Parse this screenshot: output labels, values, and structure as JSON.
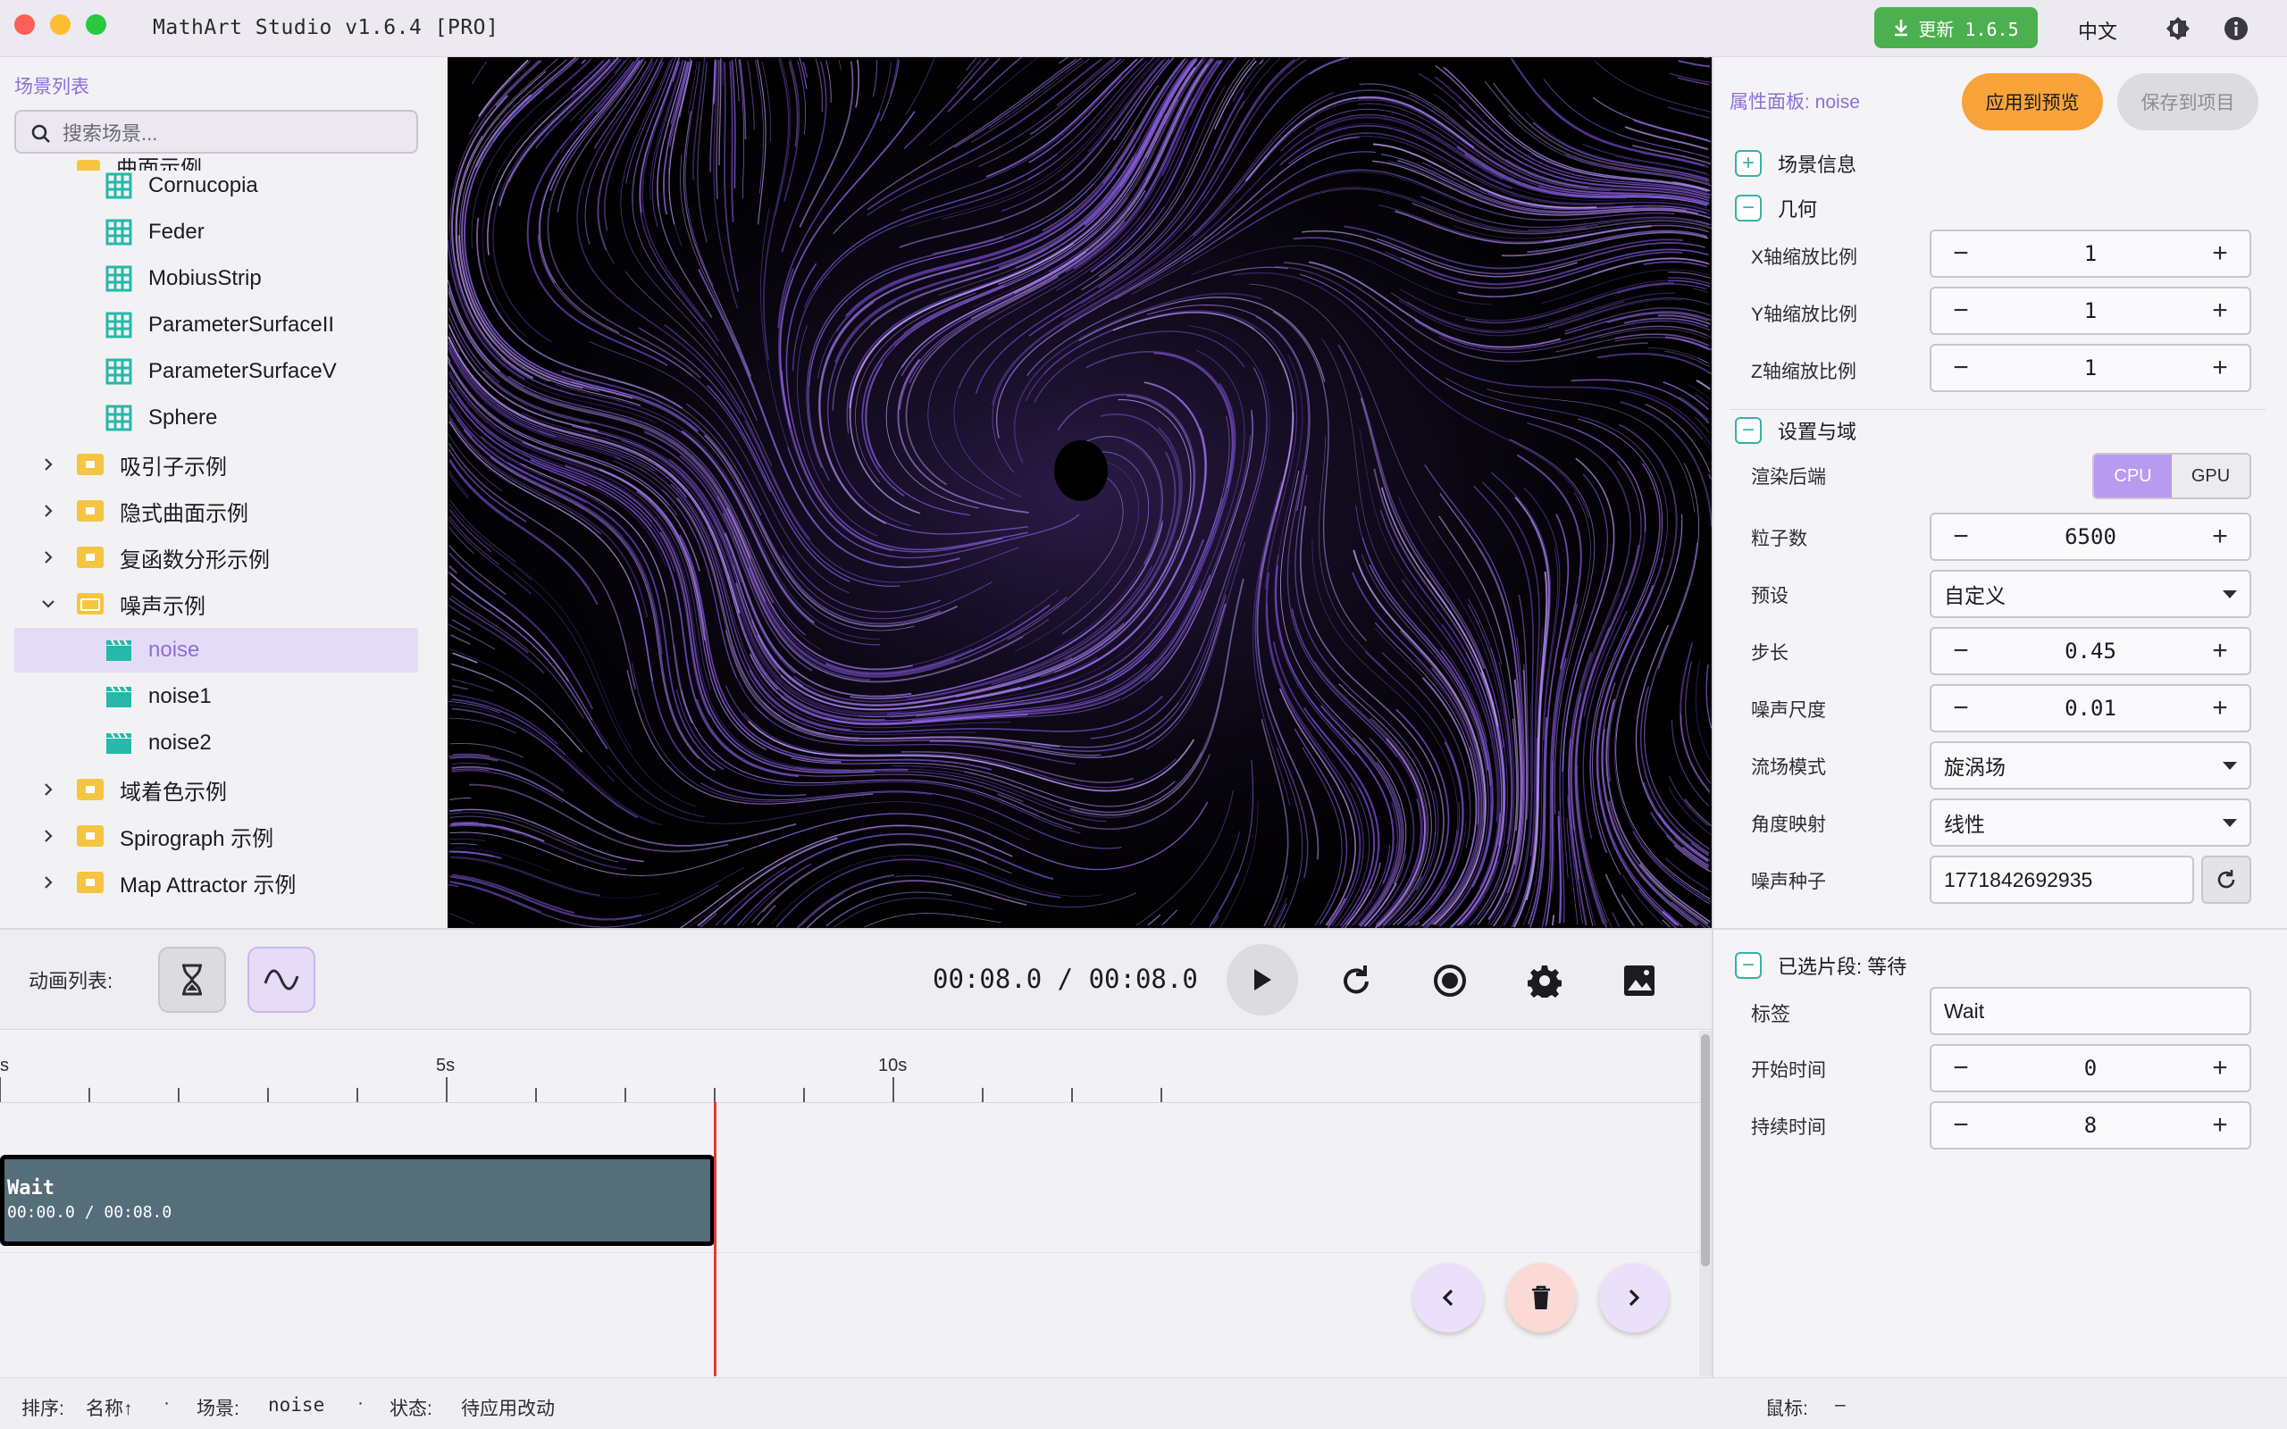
{
  "window": {
    "title": "MathArt Studio v1.6.4 [PRO]"
  },
  "header": {
    "update_label": "更新 1.6.5",
    "language": "中文",
    "theme_icon": "brightness-icon",
    "info_icon": "info-icon",
    "colors": {
      "update": "#4caf50",
      "accent": "#8d6fd6"
    }
  },
  "sidebar": {
    "title": "场景列表",
    "search_placeholder": "搜索场景...",
    "partial_group": "曲面示例",
    "items": [
      {
        "label": "Cornucopia",
        "type": "grid"
      },
      {
        "label": "Feder",
        "type": "grid"
      },
      {
        "label": "MobiusStrip",
        "type": "grid"
      },
      {
        "label": "ParameterSurfaceII",
        "type": "grid"
      },
      {
        "label": "ParameterSurfaceV",
        "type": "grid"
      },
      {
        "label": "Sphere",
        "type": "grid"
      },
      {
        "label": "吸引子示例",
        "type": "folder",
        "expanded": false
      },
      {
        "label": "隐式曲面示例",
        "type": "folder",
        "expanded": false
      },
      {
        "label": "复函数分形示例",
        "type": "folder",
        "expanded": false
      },
      {
        "label": "噪声示例",
        "type": "folder",
        "expanded": true
      },
      {
        "label": "noise",
        "type": "clip",
        "selected": true
      },
      {
        "label": "noise1",
        "type": "clip"
      },
      {
        "label": "noise2",
        "type": "clip"
      },
      {
        "label": "域着色示例",
        "type": "folder",
        "expanded": false
      },
      {
        "label": "Spirograph 示例",
        "type": "folder",
        "expanded": false
      },
      {
        "label": "Map Attractor 示例",
        "type": "folder",
        "expanded": false
      }
    ]
  },
  "props": {
    "title": "属性面板: noise",
    "apply_label": "应用到预览",
    "save_label": "保存到项目",
    "sections": {
      "scene_info": "场景信息",
      "geometry": "几何",
      "settings": "设置与域",
      "selected_clip": "已选片段: 等待"
    },
    "geometry": {
      "x_label": "X轴缩放比例",
      "x_value": "1",
      "y_label": "Y轴缩放比例",
      "y_value": "1",
      "z_label": "Z轴缩放比例",
      "z_value": "1"
    },
    "settings": {
      "backend_label": "渲染后端",
      "backend_cpu": "CPU",
      "backend_gpu": "GPU",
      "backend_selected": "CPU",
      "particles_label": "粒子数",
      "particles_value": "6500",
      "preset_label": "预设",
      "preset_value": "自定义",
      "step_label": "步长",
      "step_value": "0.45",
      "noise_scale_label": "噪声尺度",
      "noise_scale_value": "0.01",
      "flow_mode_label": "流场模式",
      "flow_mode_value": "旋涡场",
      "angle_map_label": "角度映射",
      "angle_map_value": "线性",
      "seed_label": "噪声种子",
      "seed_value": "1771842692935"
    },
    "clip": {
      "tag_label": "标签",
      "tag_value": "Wait",
      "start_label": "开始时间",
      "start_value": "0",
      "duration_label": "持续时间",
      "duration_value": "8"
    }
  },
  "toolbar": {
    "anim_list_label": "动画列表:",
    "time_display": "00:08.0 / 00:08.0"
  },
  "timeline": {
    "ticks": [
      "s",
      "5s",
      "10s"
    ],
    "clip_name": "Wait",
    "clip_time": "00:00.0 / 00:08.0",
    "playhead_seconds": 8.0
  },
  "status": {
    "sort_label": "排序:",
    "sort_value": "名称↑",
    "scene_label": "场景:",
    "scene_value": "noise",
    "state_label": "状态:",
    "state_value": "待应用改动",
    "mouse_label": "鼠标:",
    "mouse_value": "–"
  }
}
